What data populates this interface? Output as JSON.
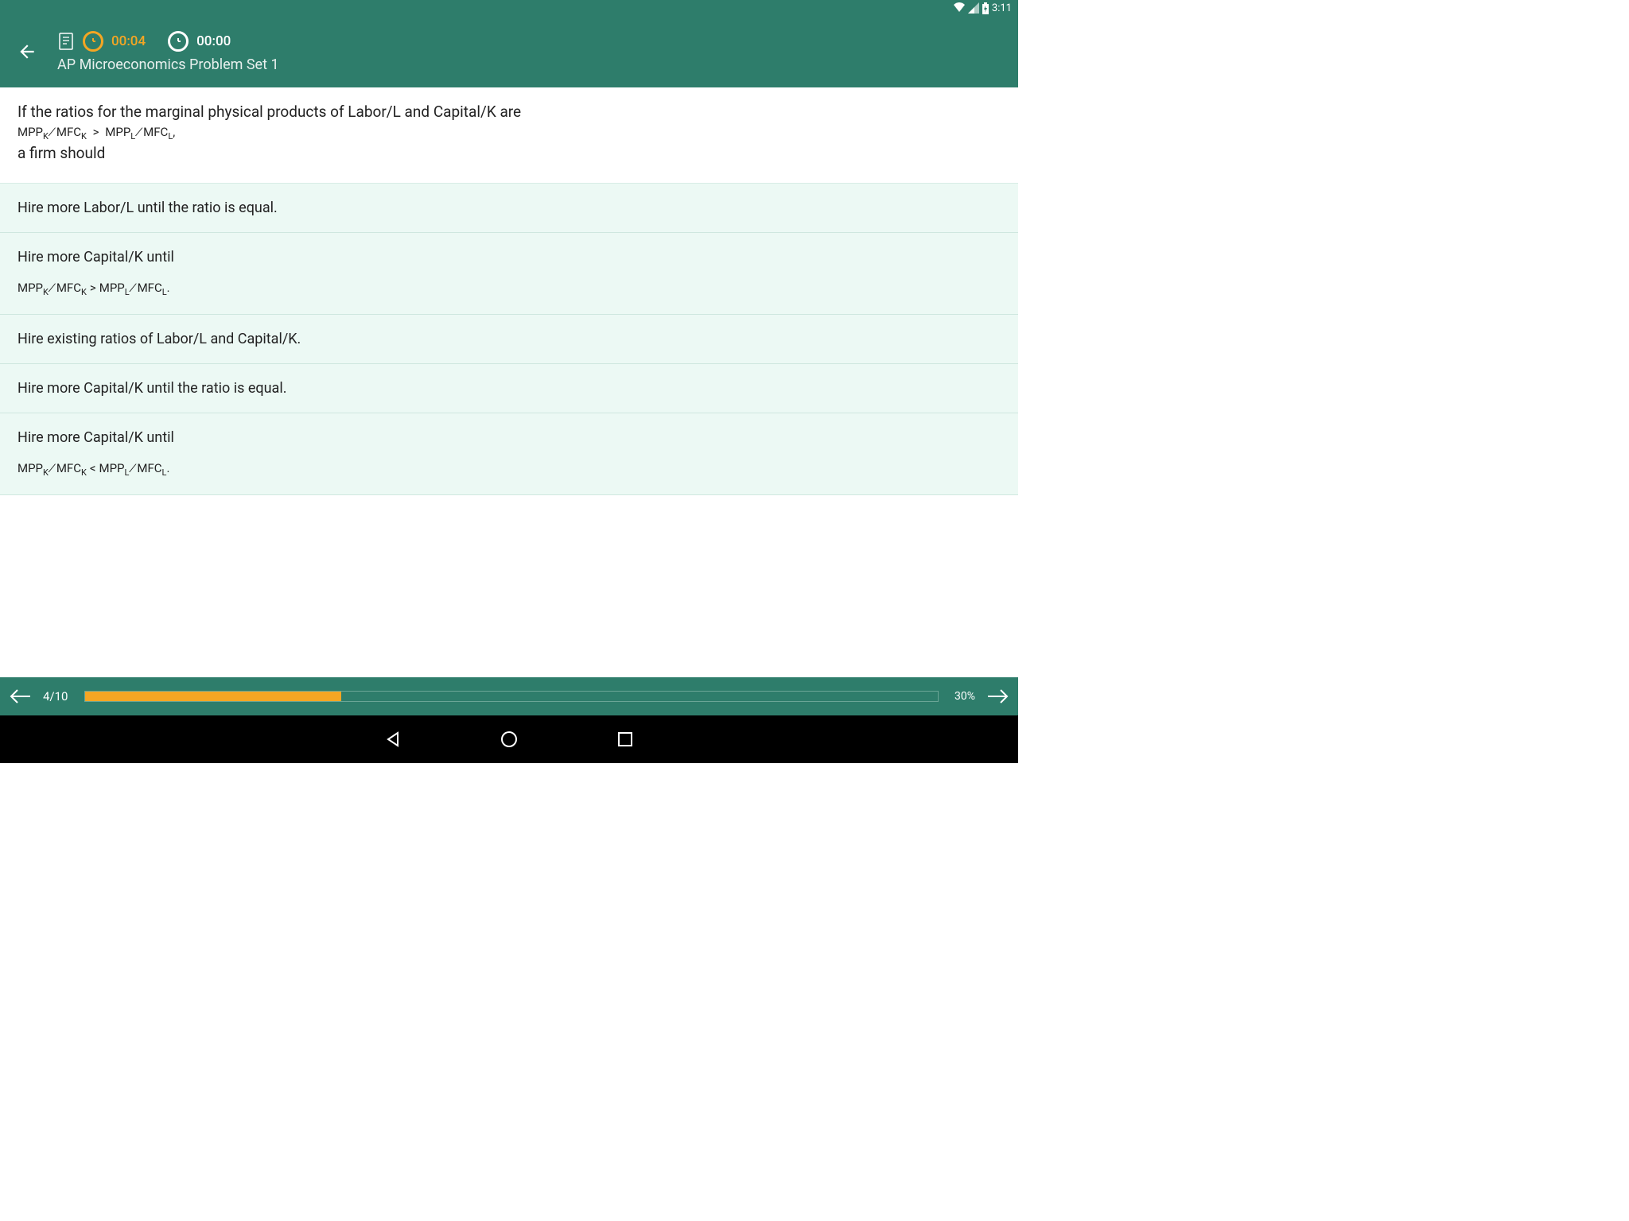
{
  "status": {
    "time": "3:11"
  },
  "header": {
    "timer_yellow": "00:04",
    "timer_white": "00:00",
    "title": "AP Microeconomics Problem Set 1"
  },
  "question": {
    "line1": "If the ratios for the marginal physical products of Labor/L and Capital/K are",
    "formula": {
      "lhs_top": "MPP",
      "lhs_ts": "K",
      "lhs_bot": "MFC",
      "lhs_bs": "K",
      "op": ">",
      "rhs_top": "MPP",
      "rhs_ts": "L",
      "rhs_bot": "MFC",
      "rhs_bs": "L",
      "tail": ","
    },
    "line2": "a firm should"
  },
  "options": [
    {
      "text": "Hire more Labor/L until the ratio is equal.",
      "has_formula": false
    },
    {
      "text": "Hire more Capital/K until",
      "has_formula": true,
      "formula": {
        "lhs_top": "MPP",
        "lhs_ts": "K",
        "lhs_bot": "MFC",
        "lhs_bs": "K",
        "op": ">",
        "rhs_top": "MPP",
        "rhs_ts": "L",
        "rhs_bot": "MFC",
        "rhs_bs": "L",
        "tail": "."
      }
    },
    {
      "text": "Hire existing ratios of Labor/L and Capital/K.",
      "has_formula": false
    },
    {
      "text": "Hire more Capital/K until the ratio is equal.",
      "has_formula": false
    },
    {
      "text": "Hire more Capital/K until",
      "has_formula": true,
      "formula": {
        "lhs_top": "MPP",
        "lhs_ts": "K",
        "lhs_bot": "MFC",
        "lhs_bs": "K",
        "op": "<",
        "rhs_top": "MPP",
        "rhs_ts": "L",
        "rhs_bot": "MFC",
        "rhs_bs": "L",
        "tail": "."
      }
    }
  ],
  "footer": {
    "position": "4/10",
    "percent": "30%",
    "progress_pct": 30
  }
}
